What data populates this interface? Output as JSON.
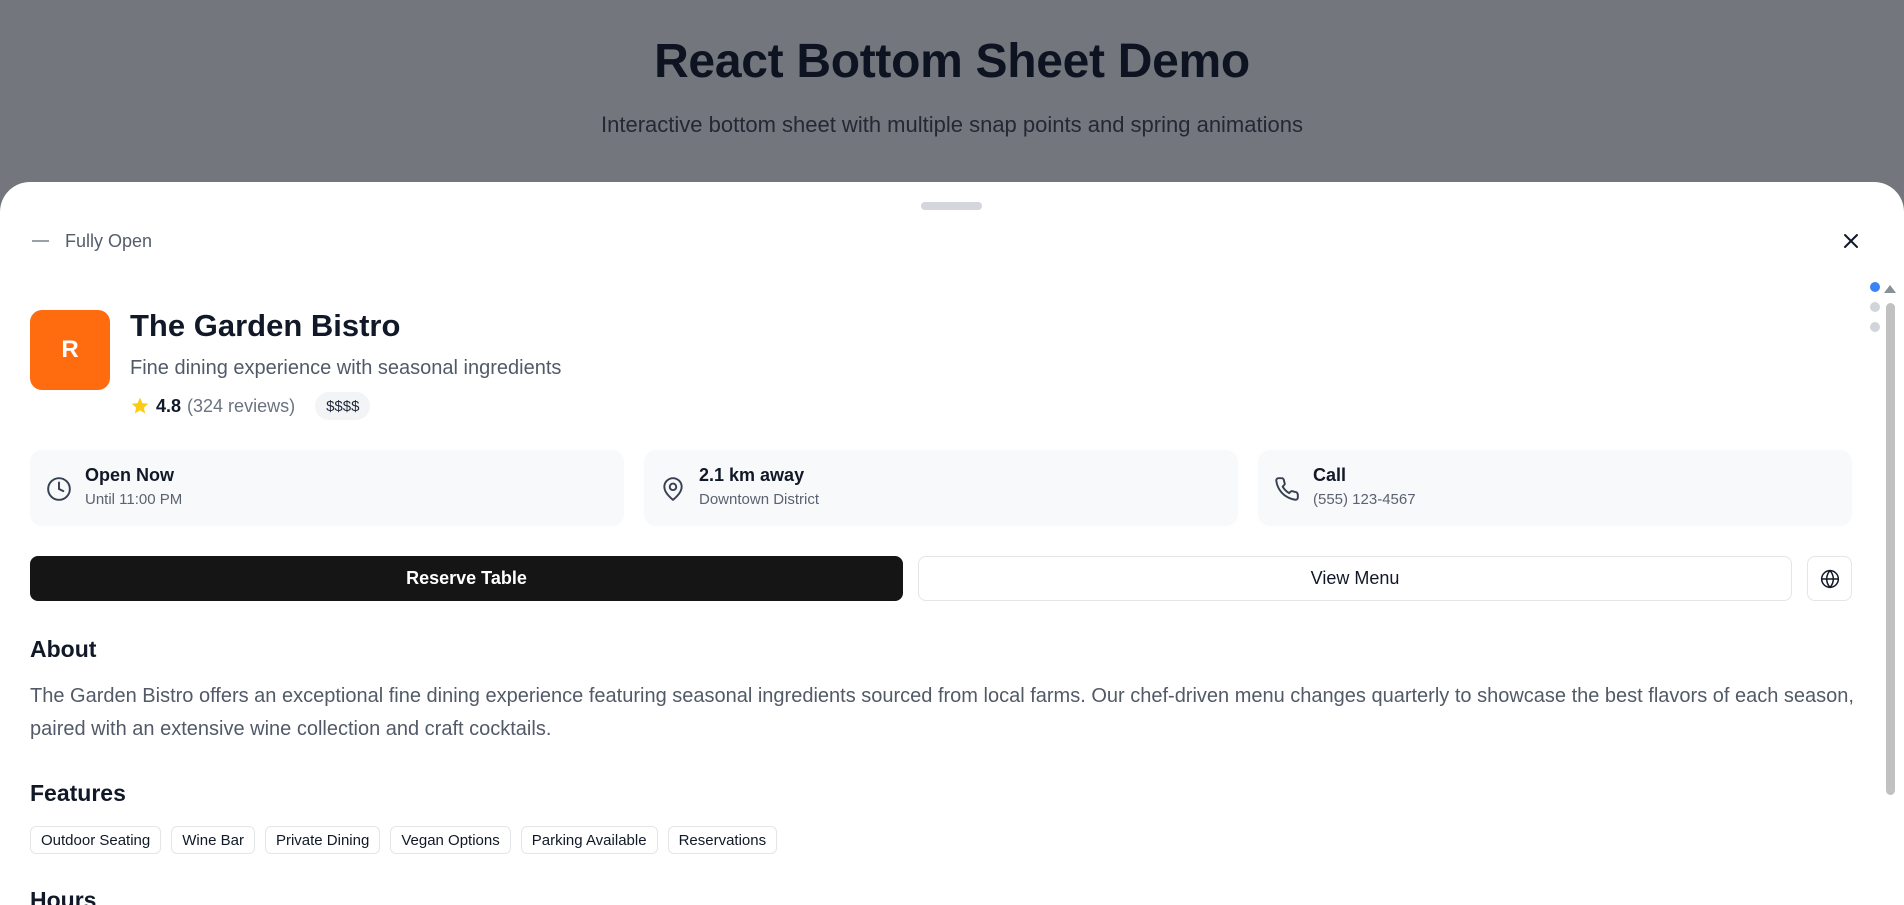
{
  "page": {
    "title": "React Bottom Sheet Demo",
    "subtitle": "Interactive bottom sheet with multiple snap points and spring animations"
  },
  "sheet": {
    "snap_label": "Fully Open",
    "snap_points_count": 3,
    "active_snap_index": 0
  },
  "restaurant": {
    "logo_letter": "R",
    "name": "The Garden Bistro",
    "tagline": "Fine dining experience with seasonal ingredients",
    "rating": "4.8",
    "reviews": "(324 reviews)",
    "price": "$$$$",
    "logo_color": "#ff6b0f"
  },
  "info_cards": [
    {
      "icon": "clock-icon",
      "title": "Open Now",
      "sub": "Until 11:00 PM"
    },
    {
      "icon": "map-pin-icon",
      "title": "2.1 km away",
      "sub": "Downtown District"
    },
    {
      "icon": "phone-icon",
      "title": "Call",
      "sub": "(555) 123-4567"
    }
  ],
  "actions": {
    "reserve_label": "Reserve Table",
    "menu_label": "View Menu",
    "website_icon": "globe-icon"
  },
  "about": {
    "heading": "About",
    "text": "The Garden Bistro offers an exceptional fine dining experience featuring seasonal ingredients sourced from local farms. Our chef-driven menu changes quarterly to showcase the best flavors of each season, paired with an extensive wine collection and craft cocktails."
  },
  "features": {
    "heading": "Features",
    "items": [
      "Outdoor Seating",
      "Wine Bar",
      "Private Dining",
      "Vegan Options",
      "Parking Available",
      "Reservations"
    ]
  },
  "hours": {
    "heading": "Hours"
  },
  "colors": {
    "accent": "#3b82f6",
    "primary_button": "#151515",
    "star": "#facc15",
    "overlay": "#73767d"
  }
}
